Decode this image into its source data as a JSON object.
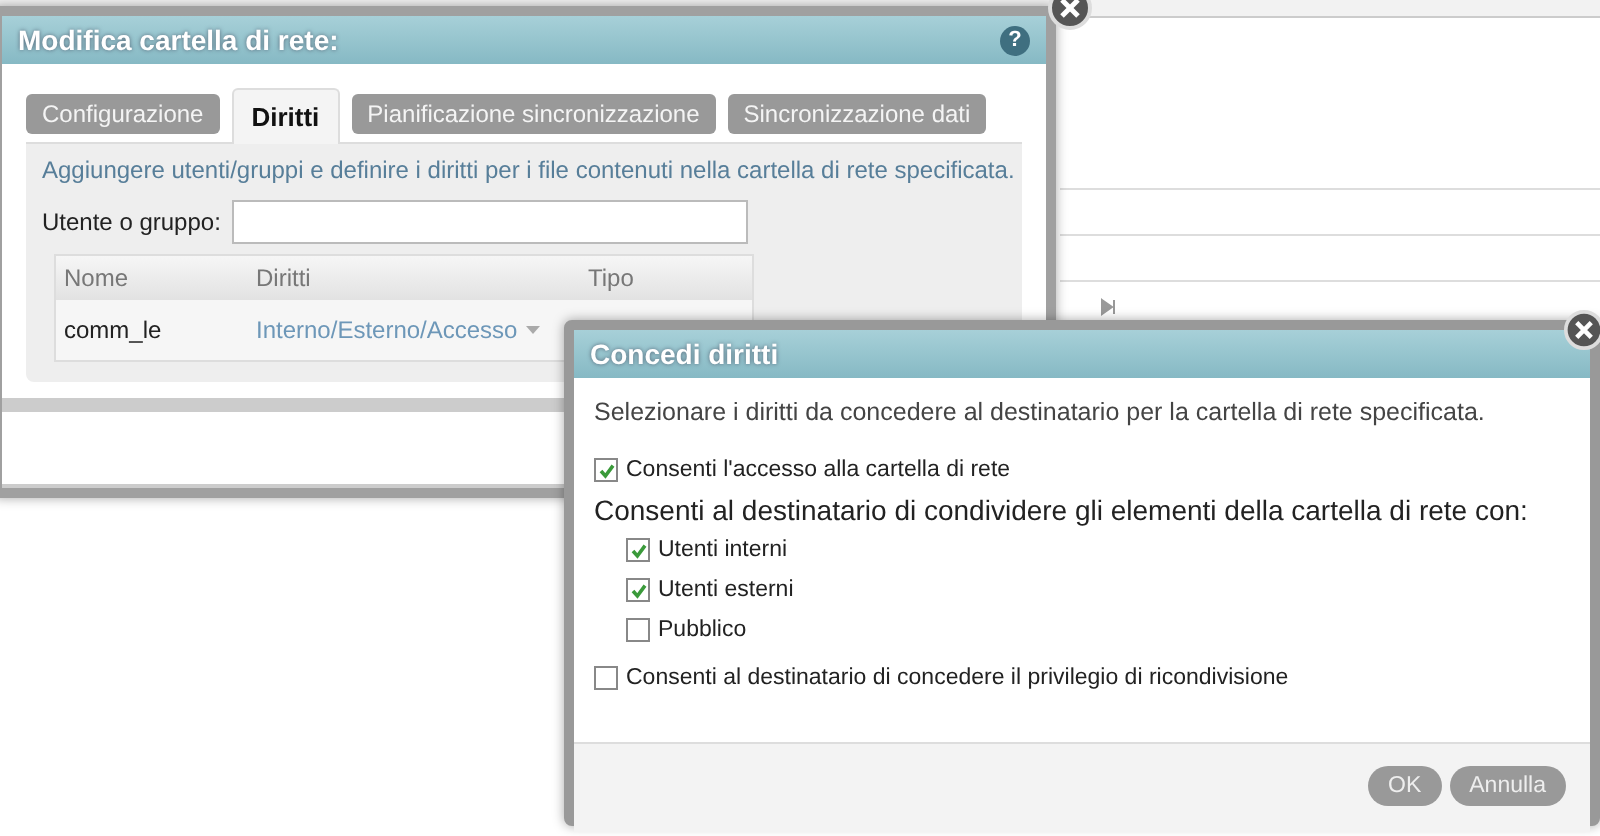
{
  "edit_dialog": {
    "title": "Modifica cartella di rete:",
    "help": "?",
    "tabs": [
      {
        "label": "Configurazione",
        "selected": false
      },
      {
        "label": "Diritti",
        "selected": true
      },
      {
        "label": "Pianificazione sincronizzazione",
        "selected": false
      },
      {
        "label": "Sincronizzazione dati",
        "selected": false
      }
    ],
    "description": "Aggiungere utenti/gruppi e definire i diritti per i file contenuti nella cartella di rete specificata.",
    "user_field": {
      "label": "Utente o gruppo:"
    },
    "table": {
      "columns": [
        "Nome",
        "Diritti",
        "Tipo"
      ],
      "rows": [
        {
          "name": "comm_le",
          "rights": "Interno/Esterno/Accesso"
        }
      ]
    }
  },
  "rights_dialog": {
    "title": "Concedi diritti",
    "description": "Selezionare i diritti da concedere al destinatario per la cartella di rete specificata.",
    "access": {
      "label": "Consenti l'accesso alla cartella di rete",
      "checked": true
    },
    "share_heading": "Consenti al destinatario di condividere gli elementi della cartella di rete con:",
    "share_options": [
      {
        "label": "Utenti interni",
        "checked": true
      },
      {
        "label": "Utenti esterni",
        "checked": true
      },
      {
        "label": "Pubblico",
        "checked": false
      }
    ],
    "reshare": {
      "label": "Consenti al destinatario di concedere il privilegio di ricondivisione",
      "checked": false
    },
    "buttons": [
      "OK",
      "Annulla"
    ]
  }
}
